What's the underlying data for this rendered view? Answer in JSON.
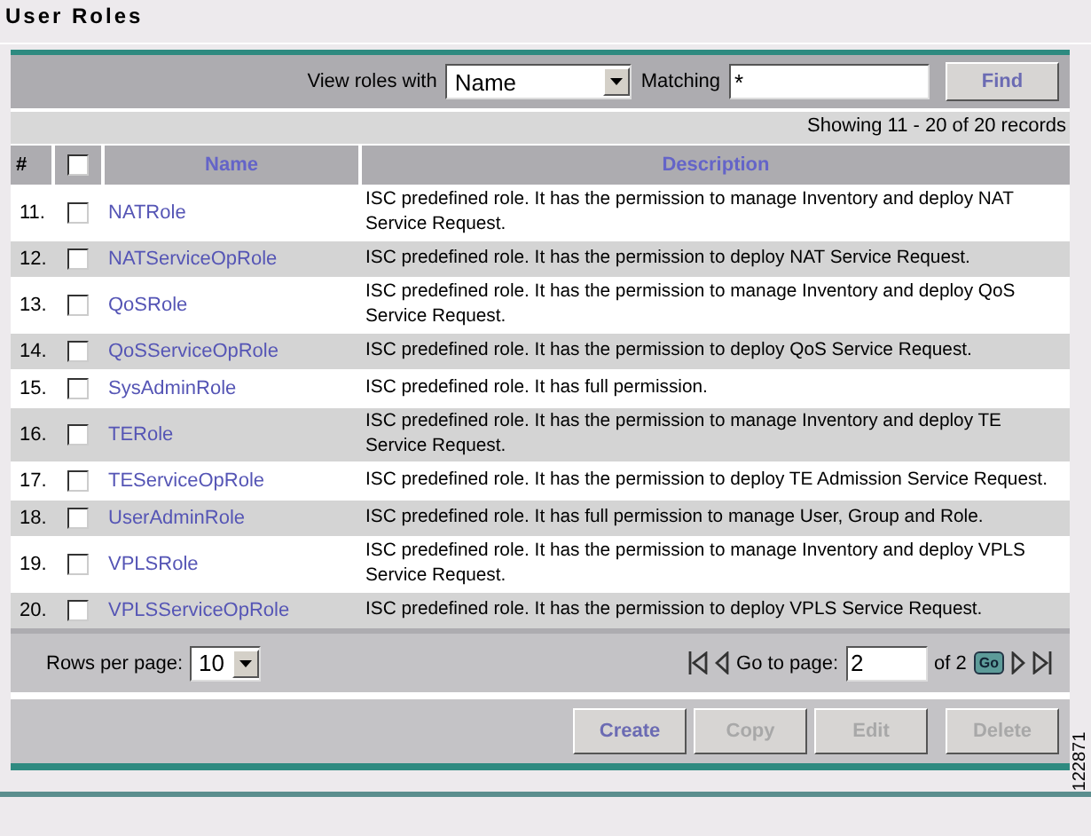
{
  "page_title": "User Roles",
  "filter": {
    "label": "View roles with",
    "field": "Name",
    "matching_label": "Matching",
    "matching_value": "*",
    "find_button": "Find"
  },
  "record_count": "Showing 11 - 20 of 20 records",
  "table": {
    "columns": [
      "#",
      "Name",
      "Description"
    ],
    "header_checked": false,
    "rows": [
      {
        "number": "11.",
        "checked": false,
        "name": "NATRole",
        "description": "ISC predefined role. It has the permission to manage Inventory and deploy NAT Service Request."
      },
      {
        "number": "12.",
        "checked": false,
        "name": "NATServiceOpRole",
        "description": "ISC predefined role. It has the permission to deploy NAT Service Request."
      },
      {
        "number": "13.",
        "checked": false,
        "name": "QoSRole",
        "description": "ISC predefined role. It has the permission to manage Inventory and deploy QoS Service Request."
      },
      {
        "number": "14.",
        "checked": false,
        "name": "QoSServiceOpRole",
        "description": "ISC predefined role. It has the permission to deploy QoS Service Request."
      },
      {
        "number": "15.",
        "checked": false,
        "name": "SysAdminRole",
        "description": "ISC predefined role. It has full permission."
      },
      {
        "number": "16.",
        "checked": false,
        "name": "TERole",
        "description": "ISC predefined role. It has the permission to manage Inventory and deploy TE Service Request."
      },
      {
        "number": "17.",
        "checked": false,
        "name": "TEServiceOpRole",
        "description": "ISC predefined role. It has the permission to deploy TE Admission Service Request."
      },
      {
        "number": "18.",
        "checked": false,
        "name": "UserAdminRole",
        "description": "ISC predefined role. It has full permission to manage User, Group and Role."
      },
      {
        "number": "19.",
        "checked": false,
        "name": "VPLSRole",
        "description": "ISC predefined role. It has the permission to manage Inventory and deploy VPLS Service Request."
      },
      {
        "number": "20.",
        "checked": false,
        "name": "VPLSServiceOpRole",
        "description": "ISC predefined role. It has the permission to deploy VPLS Service Request."
      }
    ]
  },
  "pagination": {
    "rows_label": "Rows per page:",
    "rows_value": "10",
    "goto_label": "Go to page:",
    "page_value": "2",
    "of_label": "of 2",
    "go_button": "Go"
  },
  "actions": [
    {
      "label": "Create",
      "disabled": false
    },
    {
      "label": "Copy",
      "disabled": true
    },
    {
      "label": "Edit",
      "disabled": true
    },
    {
      "label": "Delete",
      "disabled": true
    }
  ],
  "figure_number": "122871"
}
